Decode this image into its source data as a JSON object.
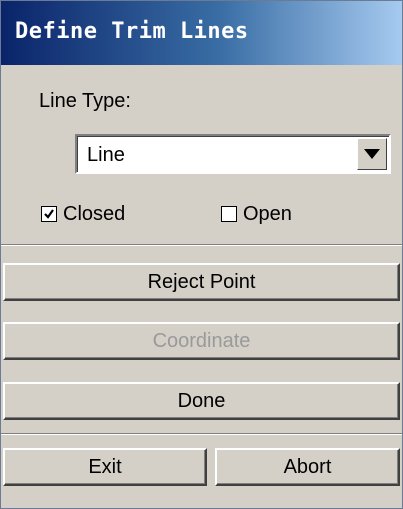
{
  "window": {
    "title": "Define Trim Lines"
  },
  "line_type": {
    "label": "Line Type:",
    "selected": "Line"
  },
  "options": {
    "closed": {
      "label": "Closed",
      "checked": true
    },
    "open": {
      "label": "Open",
      "checked": false
    }
  },
  "buttons": {
    "reject_point": "Reject Point",
    "coordinate": "Coordinate",
    "done": "Done",
    "exit": "Exit",
    "abort": "Abort"
  },
  "colors": {
    "title_gradient_start": "#0a246a",
    "title_gradient_end": "#a6caf0",
    "panel_background": "#d4d0c8",
    "disabled_text": "#9a9a9a"
  },
  "icons": {
    "dropdown": "triangle-down-icon",
    "checkmark": "checkmark-icon"
  }
}
